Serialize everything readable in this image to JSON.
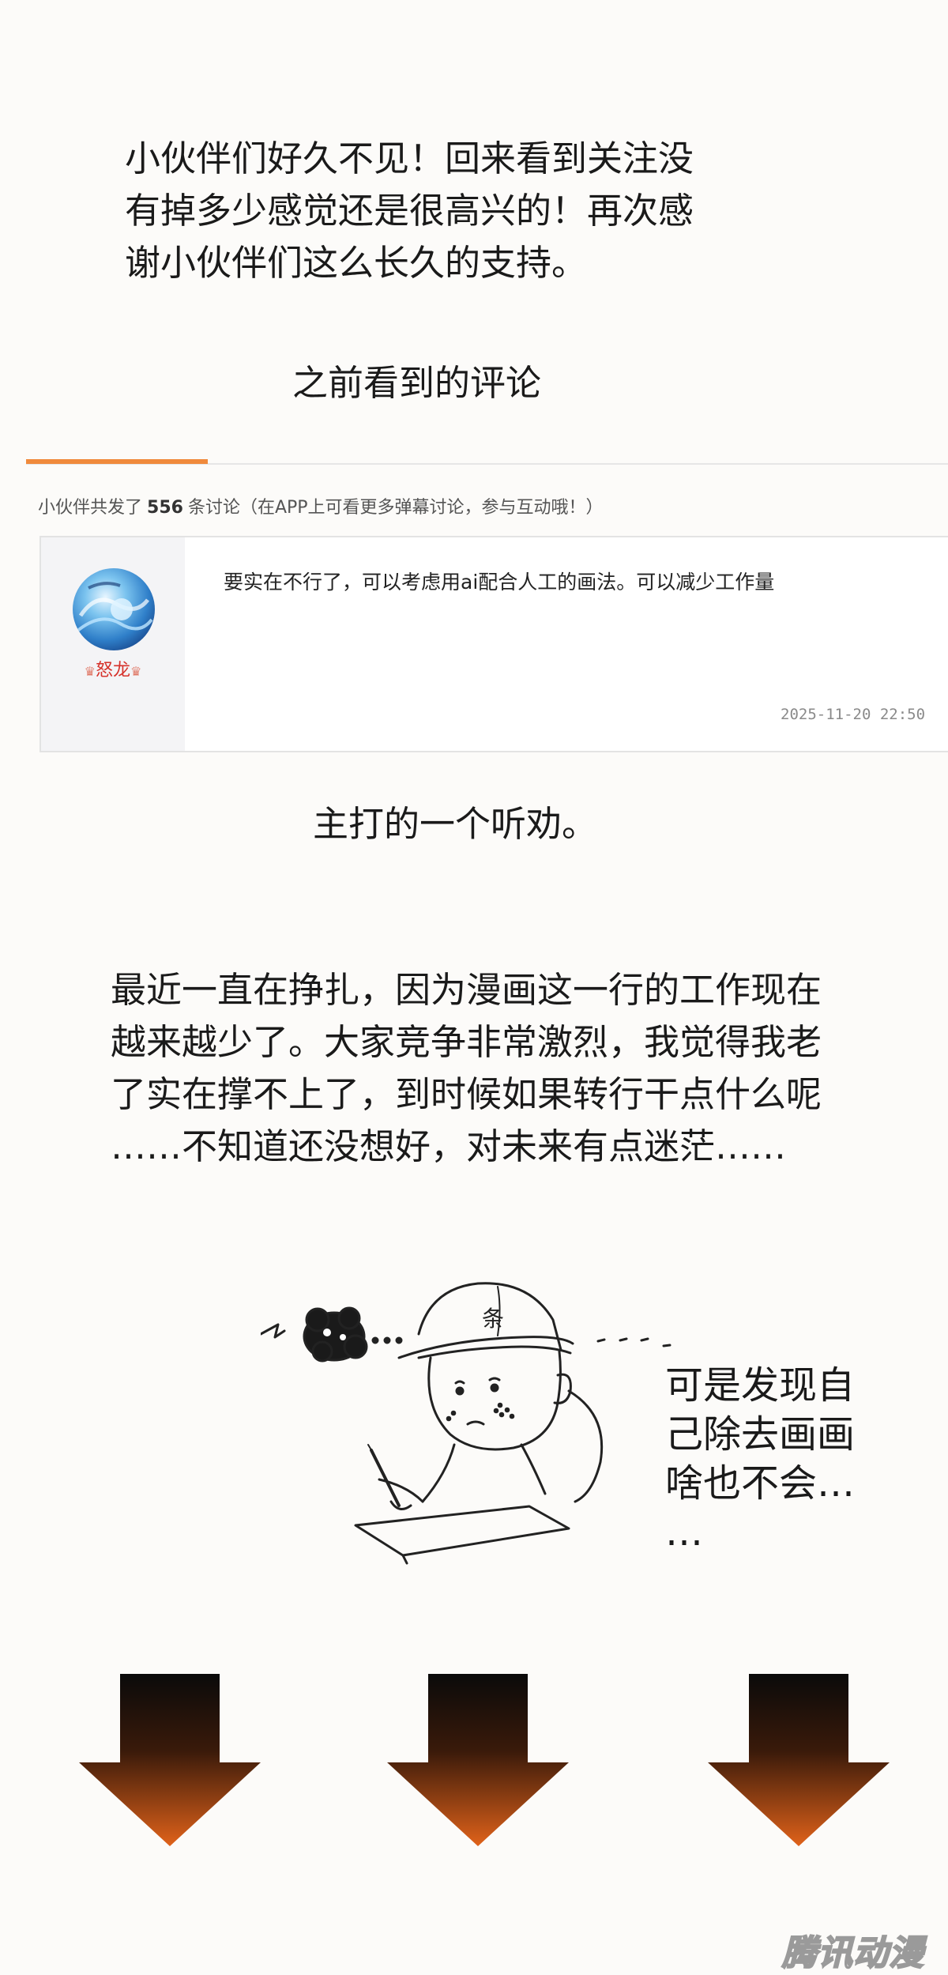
{
  "intro": {
    "text": "小伙伴们好久不见！回来看到关注没\n有掉多少感觉还是很高兴的！再次感\n谢小伙伴们这么长久的支持。"
  },
  "caption_before": "之前看到的评论",
  "comment_panel": {
    "count_prefix": "小伙伴共发了",
    "count": "556",
    "count_suffix": "条讨论（在APP上可看更多弹幕讨论，参与互动哦！）",
    "comment": {
      "username": "怒龙",
      "body": "要实在不行了，可以考虑用ai配合人工的画法。可以减少工作量",
      "timestamp": "2025-11-20 22:50"
    },
    "accent_color": "#f08a3c"
  },
  "caption_advice": "主打的一个听劝。",
  "struggle": {
    "text": "最近一直在挣扎，因为漫画这一行的工作现在\n越来越少了。大家竞争非常激烈，我觉得我老\n了实在撑不上了，到时候如果转行干点什么呢\n……不知道还没想好，对未来有点迷茫……"
  },
  "sketch": {
    "cap_glyph": "条",
    "thought": "可是发现自\n己除去画画\n啥也不会…\n…"
  },
  "arrows": {
    "count": 3,
    "gradient_top": "#0a0a0a",
    "gradient_bottom": "#e0621a"
  },
  "watermark": "腾讯动漫"
}
